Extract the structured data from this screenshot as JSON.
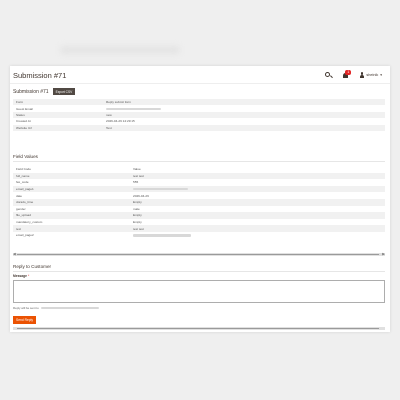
{
  "header": {
    "title": "Submission #71",
    "notification_count": "1",
    "user_name": "sheinik"
  },
  "submission": {
    "title": "Submission #71",
    "export_label": "Export CSV"
  },
  "info_rows": [
    {
      "key": "Form",
      "value": "Reply submit form"
    },
    {
      "key": "Guest Email",
      "value": ""
    },
    {
      "key": "Status",
      "value": "new"
    },
    {
      "key": "Created At",
      "value": "2026-04-29 14:29:15"
    },
    {
      "key": "Website Url",
      "value": "Test"
    }
  ],
  "field_values": {
    "title": "Field Values",
    "rows": [
      {
        "key": "Field Code",
        "value": "Value"
      },
      {
        "key": "full_name",
        "value": "test test"
      },
      {
        "key": "fax_code",
        "value": "555"
      },
      {
        "key": "email_page1",
        "value": ""
      },
      {
        "key": "date",
        "value": "2026-04-29"
      },
      {
        "key": "dorado_time",
        "value": "Empty"
      },
      {
        "key": "gender",
        "value": "male"
      },
      {
        "key": "file_upload",
        "value": "Empty"
      },
      {
        "key": "mandatory_custom",
        "value": "Empty"
      },
      {
        "key": "text",
        "value": "test test"
      },
      {
        "key": "email_page2",
        "value": ""
      }
    ]
  },
  "reply": {
    "title": "Reply to Customer",
    "message_label": "Message",
    "required_mark": "*",
    "note": "Reply will be sent to",
    "send_label": "Send Reply"
  },
  "scroll": {
    "left_arrow": "◀",
    "right_arrow": "▶"
  },
  "colors": {
    "accent": "#eb5202",
    "dark_button": "#514943",
    "badge": "#e22626"
  }
}
